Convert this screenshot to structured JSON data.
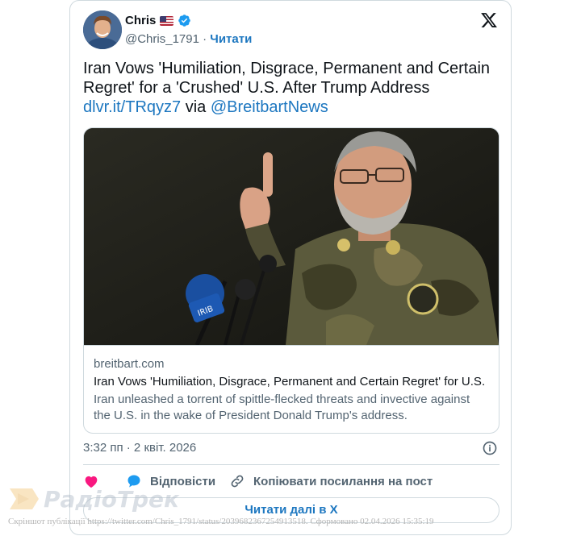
{
  "tweet": {
    "author_name": "Chris",
    "author_flag": "US flag",
    "handle": "@Chris_1791",
    "separator": "·",
    "follow_label": "Читати",
    "text_main": "Iran Vows 'Humiliation, Disgrace, Permanent and Certain Regret' for a 'Crushed' U.S. After Trump Address",
    "text_link": "dlvr.it/TRqyz7",
    "text_via": " via ",
    "text_mention": "@BreitbartNews",
    "timestamp": "3:32 пп · 2 квіт. 2026"
  },
  "link_card": {
    "domain": "breitbart.com",
    "title": "Iran Vows 'Humiliation, Disgrace, Permanent and Certain Regret' for U.S.",
    "description": "Iran unleashed a torrent of spittle-flecked threats and invective against the U.S. in the wake of President Donald Trump's address.",
    "image_alt": "Military officer speaking at microphones, finger raised"
  },
  "actions": {
    "like_icon": "heart-icon",
    "reply_label": "Відповісти",
    "copy_label": "Копіювати посилання на пост",
    "read_more_label": "Читати далі в X"
  },
  "watermark": {
    "brand": "РадіоТрек"
  },
  "footer": {
    "note": "Скріншот публікації https://twitter.com/Chris_1791/status/2039682367254913518. Сформовано 02.04.2026 15:35:19"
  },
  "colors": {
    "accent_blue": "#1d77c0",
    "verified_blue": "#1d9bf0",
    "like_pink": "#f91880",
    "text_primary": "#0f1419",
    "text_secondary": "#536471",
    "border": "#cfd9de"
  }
}
